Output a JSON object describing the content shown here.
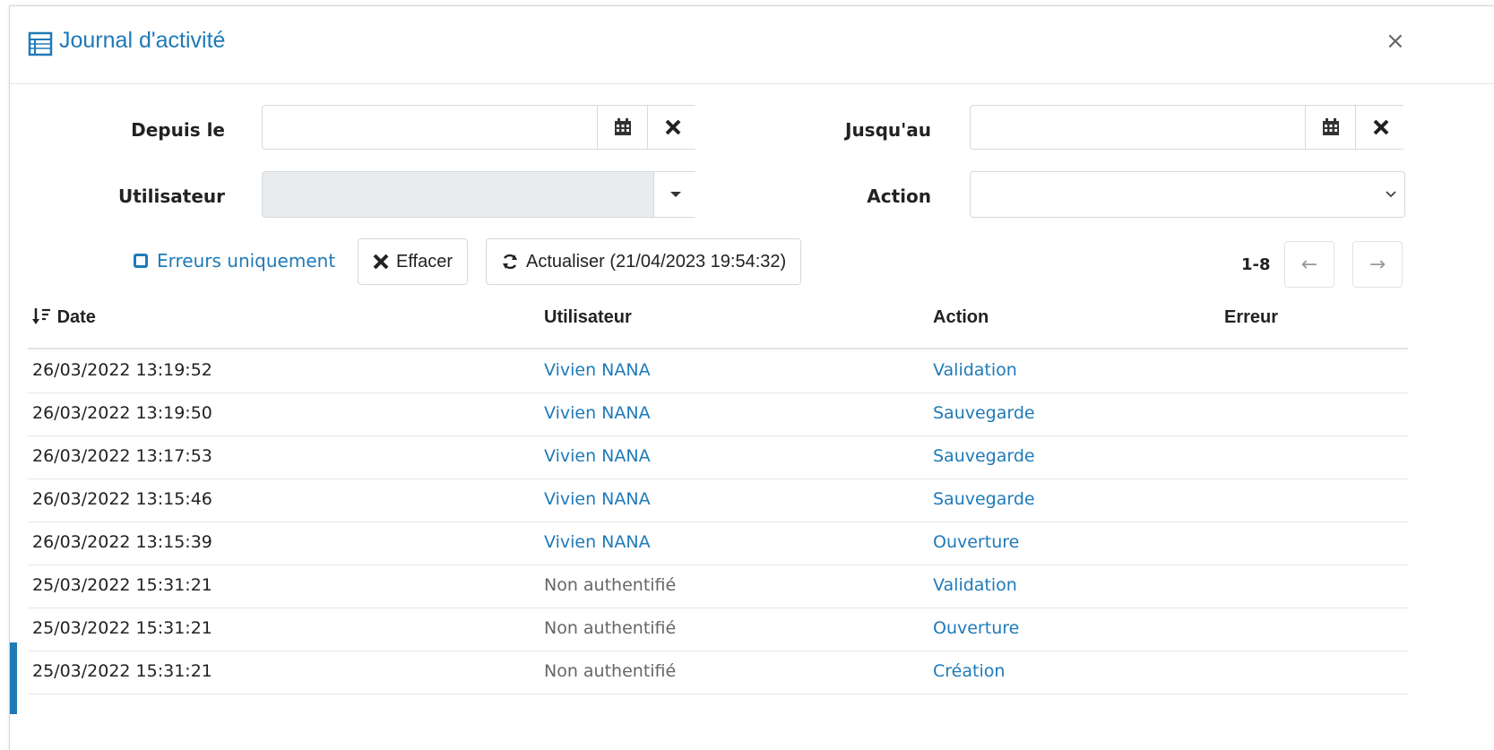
{
  "dialog": {
    "title": "Journal d'activité",
    "close_label": "×"
  },
  "filters": {
    "from_label": "Depuis le",
    "from_value": "",
    "to_label": "Jusqu'au",
    "to_value": "",
    "user_label": "Utilisateur",
    "user_value": "",
    "action_label": "Action",
    "action_value": ""
  },
  "toolbar": {
    "errors_only_label": "Erreurs uniquement",
    "clear_label": "Effacer",
    "refresh_label": "Actualiser (21/04/2023 19:54:32)",
    "pagination_range": "1-8",
    "prev_label": "←",
    "next_label": "→"
  },
  "table": {
    "columns": [
      "Date",
      "Utilisateur",
      "Action",
      "Erreur"
    ],
    "rows": [
      {
        "date": "26/03/2022 13:19:52",
        "user": "Vivien NANA",
        "action": "Validation",
        "error": ""
      },
      {
        "date": "26/03/2022 13:19:50",
        "user": "Vivien NANA",
        "action": "Sauvegarde",
        "error": ""
      },
      {
        "date": "26/03/2022 13:17:53",
        "user": "Vivien NANA",
        "action": "Sauvegarde",
        "error": ""
      },
      {
        "date": "26/03/2022 13:15:46",
        "user": "Vivien NANA",
        "action": "Sauvegarde",
        "error": ""
      },
      {
        "date": "26/03/2022 13:15:39",
        "user": "Vivien NANA",
        "action": "Ouverture",
        "error": ""
      },
      {
        "date": "25/03/2022 15:31:21",
        "user": "Non authentifié",
        "action": "Validation",
        "error": ""
      },
      {
        "date": "25/03/2022 15:31:21",
        "user": "Non authentifié",
        "action": "Ouverture",
        "error": ""
      },
      {
        "date": "25/03/2022 15:31:21",
        "user": "Non authentifié",
        "action": "Création",
        "error": ""
      }
    ]
  },
  "colors": {
    "accent": "#1f7ab8",
    "muted": "#666666"
  },
  "icons": {
    "title": "table-list-icon",
    "calendar": "calendar-icon",
    "clear": "times-icon",
    "refresh": "refresh-icon",
    "sort": "sort-down-icon",
    "dropdown": "caret-down-icon"
  }
}
